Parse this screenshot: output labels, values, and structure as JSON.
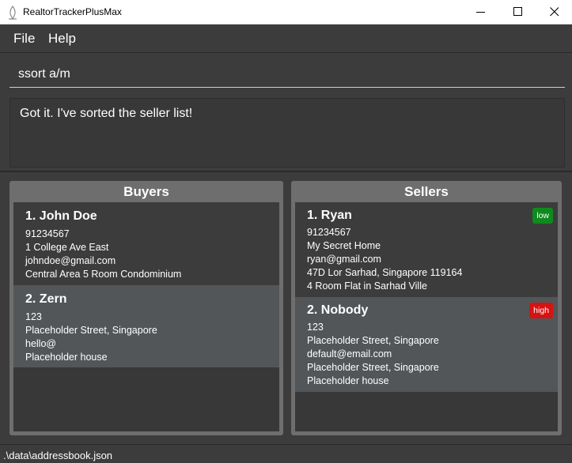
{
  "window": {
    "title": "RealtorTrackerPlusMax"
  },
  "menu": {
    "file": "File",
    "help": "Help"
  },
  "command": {
    "value": "ssort a/m"
  },
  "result": {
    "message": "Got it. I've sorted the seller list!"
  },
  "buyers": {
    "header": "Buyers",
    "items": [
      {
        "name": "1.  John Doe",
        "phone": "91234567",
        "address": "1 College Ave East",
        "email": "johndoe@gmail.com",
        "info": "Central Area 5 Room Condominium"
      },
      {
        "name": "2.  Zern",
        "phone": "123",
        "address": "Placeholder Street, Singapore",
        "email": "hello@",
        "info": "Placeholder house"
      }
    ]
  },
  "sellers": {
    "header": "Sellers",
    "items": [
      {
        "name": "1.  Ryan",
        "tag": "low",
        "phone": "91234567",
        "address": "My Secret Home",
        "email": "ryan@gmail.com",
        "property_address": "47D Lor Sarhad, Singapore 119164",
        "info": "4 Room Flat in Sarhad Ville"
      },
      {
        "name": "2.  Nobody",
        "tag": "high",
        "phone": "123",
        "address": "Placeholder Street, Singapore",
        "email": "default@email.com",
        "property_address": "Placeholder Street, Singapore",
        "info": "Placeholder house"
      }
    ]
  },
  "status": {
    "file_path": ".\\data\\addressbook.json"
  },
  "colors": {
    "tag_low": "#0f8a1e",
    "tag_high": "#d61313",
    "background": "#3c3c3c"
  }
}
